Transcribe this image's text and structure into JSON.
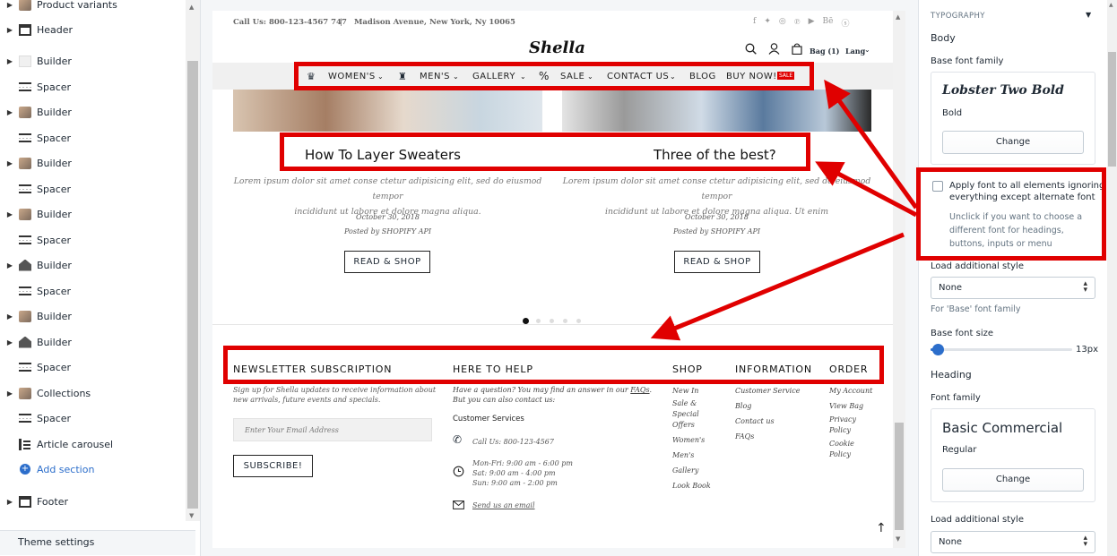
{
  "sidebar": {
    "items": [
      {
        "label": "Product variants",
        "icon": "image-thumb-icon"
      },
      {
        "label": "Header",
        "icon": "header-icon"
      },
      {
        "label": "Builder",
        "icon": "blank-thumb-icon"
      },
      {
        "label": "Spacer",
        "icon": "spacer-icon"
      },
      {
        "label": "Builder",
        "icon": "image-thumb-icon"
      },
      {
        "label": "Spacer",
        "icon": "spacer-icon"
      },
      {
        "label": "Builder",
        "icon": "image-thumb-icon"
      },
      {
        "label": "Spacer",
        "icon": "spacer-icon"
      },
      {
        "label": "Builder",
        "icon": "image-thumb-icon"
      },
      {
        "label": "Spacer",
        "icon": "spacer-icon"
      },
      {
        "label": "Builder",
        "icon": "house-icon"
      },
      {
        "label": "Spacer",
        "icon": "spacer-icon"
      },
      {
        "label": "Builder",
        "icon": "image-thumb-icon"
      },
      {
        "label": "Builder",
        "icon": "house-icon"
      },
      {
        "label": "Spacer",
        "icon": "spacer-icon"
      },
      {
        "label": "Collections",
        "icon": "image-thumb-icon"
      },
      {
        "label": "Spacer",
        "icon": "spacer-icon"
      },
      {
        "label": "Article carousel",
        "icon": "article-icon"
      }
    ],
    "add_section": "Add section",
    "footer": "Footer",
    "theme_settings": "Theme settings"
  },
  "preview": {
    "topbar": {
      "call": "Call Us: 800-123-4567 747",
      "sep": "|",
      "address": "Madison Avenue, New York, Ny 10065"
    },
    "social_icons": [
      "facebook-icon",
      "twitter-icon",
      "instagram-icon",
      "pinterest-icon",
      "youtube-icon",
      "behance-icon",
      "skype-icon"
    ],
    "logo": "Shella",
    "bag": "Bag (1)",
    "lang": "Lang",
    "nav": {
      "womens": "WOMEN'S",
      "mens": "MEN'S",
      "gallery": "GALLERY",
      "percent": "%",
      "sale": "SALE",
      "contact": "CONTACT US",
      "blog": "BLOG",
      "buy": "BUY NOW!",
      "sale_badge": "SALE"
    },
    "articles": [
      {
        "title": "How To Layer Sweaters",
        "excerpt_line1": "Lorem ipsum dolor sit amet conse ctetur adipisicing elit, sed do eiusmod tempor",
        "excerpt_line2": "incididunt ut labore et dolore magna aliqua.",
        "date": "October 30, 2018",
        "author": "Posted by SHOPIFY API",
        "button": "READ & SHOP"
      },
      {
        "title": "Three of the best?",
        "excerpt_line1": "Lorem ipsum dolor sit amet conse ctetur adipisicing elit, sed do eiusmod tempor",
        "excerpt_line2": "incididunt ut labore et dolore magna aliqua. Ut enim",
        "date": "October 30, 2018",
        "author": "Posted by SHOPIFY API",
        "button": "READ & SHOP"
      }
    ],
    "carousel": {
      "total_dots": 5,
      "active_dot": 1
    },
    "footer": {
      "newsletter": {
        "heading": "NEWSLETTER SUBSCRIPTION",
        "text_line1": "Sign up for Shella updates to receive information about",
        "text_line2": "new arrivals, future events and specials.",
        "placeholder": "Enter Your Email Address",
        "button": "SUBSCRIBE!"
      },
      "help": {
        "heading": "HERE TO HELP",
        "text_line1_pre": "Have a question? You may find an answer in our ",
        "faqs": "FAQs",
        "text_line1_post": ".",
        "text_line2": "But you can also contact us:",
        "customer_services": "Customer Services",
        "phone": "Call Us: 800-123-4567",
        "hours1": "Mon-Fri: 9:00 am - 6:00 pm",
        "hours2": "Sat: 9:00 am - 4:00 pm",
        "hours3": "Sun: 9:00 am - 2:00 pm",
        "email_link": "Send us an email"
      },
      "shop": {
        "heading": "SHOP",
        "links": [
          "New In",
          "Sale &",
          "Special",
          "Offers",
          "Women's",
          "Men's",
          "Gallery",
          "Look Book"
        ]
      },
      "information": {
        "heading": "INFORMATION",
        "links": [
          "Customer Service",
          "Blog",
          "Contact us",
          "FAQs"
        ]
      },
      "order": {
        "heading": "ORDER",
        "links": [
          "My Account",
          "View Bag",
          "Privacy",
          "Policy",
          "Cookie",
          "Policy"
        ]
      }
    },
    "highlight_color": "#e00000"
  },
  "settings": {
    "section": "TYPOGRAPHY",
    "body": "Body",
    "base_font_family": "Base font family",
    "base_font_name": "Lobster Two Bold",
    "base_font_style": "Bold",
    "change": "Change",
    "apply_all_line1": "Apply font to all elements ignoring",
    "apply_all_line2": "everything except alternate font",
    "apply_help_line1": "Unclick if you want to choose a",
    "apply_help_line2": "different font for headings,",
    "apply_help_line3": "buttons, inputs or menu",
    "load_additional_style": "Load additional style",
    "none": "None",
    "for_base": "For 'Base' font family",
    "base_font_size": "Base font size",
    "base_font_size_value": "13px",
    "base_font_size_fraction": 0.05,
    "heading": "Heading",
    "font_family": "Font family",
    "heading_font_name": "Basic Commercial",
    "heading_font_style": "Regular",
    "change2": "Change",
    "load_additional_style2": "Load additional style",
    "none2": "None",
    "accent": "#2c6ecb"
  }
}
